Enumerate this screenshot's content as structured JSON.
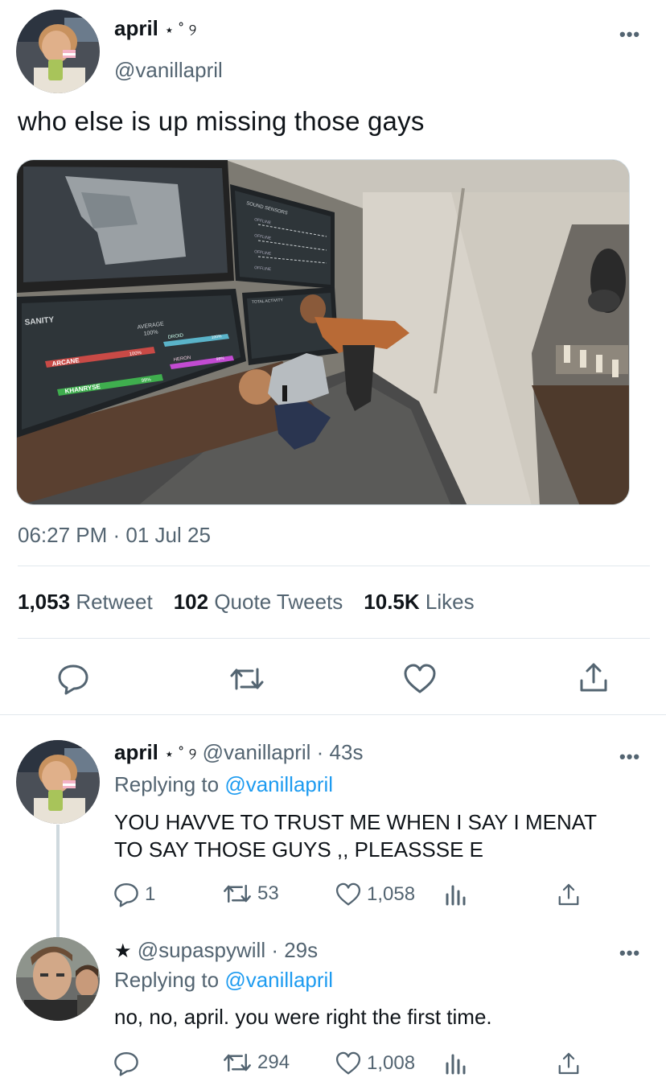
{
  "main_tweet": {
    "display_name": "april",
    "name_decor": "⋆ ˚ ୨",
    "handle": "@vanillapril",
    "text": "who else is up missing those gays",
    "timestamp": "06:27 PM · 01 Jul 25",
    "stats": {
      "retweets_count": "1,053",
      "retweets_label": "Retweet",
      "quotes_count": "102",
      "quotes_label": "Quote Tweets",
      "likes_count": "10.5K",
      "likes_label": "Likes"
    },
    "media": {
      "sanity_label": "SANITY",
      "average_label": "AVERAGE",
      "average_value": "100%",
      "players": [
        {
          "name": "ARCANE",
          "percent": "100%",
          "color": "#d9534f"
        },
        {
          "name": "KHANRYSE",
          "percent": "99%",
          "color": "#3fb950"
        },
        {
          "name": "DROID",
          "percent": "100%",
          "color": "#5bc0de"
        },
        {
          "name": "HERON",
          "percent": "99%",
          "color": "#c44bd0"
        }
      ],
      "sound_sensors_label": "SOUND SENSORS",
      "sensor_labels": [
        "OFFLINE",
        "OFFLINE",
        "OFFLINE",
        "OFFLINE"
      ],
      "activity_label": "TOTAL ACTIVITY"
    }
  },
  "replies": [
    {
      "display_name": "april",
      "name_decor": "⋆ ˚ ୨",
      "handle": "@vanillapril",
      "time": "· 43s",
      "replying_prefix": "Replying to",
      "replying_to": "@vanillapril",
      "text_line1": "YOU HAVVE TO TRUST ME WHEN I SAY I MENAT",
      "text_line2": "TO SAY THOSE GUYS ,, PLEASSSE E",
      "reply_count": "1",
      "retweet_count": "53",
      "like_count": "1,058"
    },
    {
      "display_name": "★",
      "handle": "@supaspywill",
      "time": "· 29s",
      "replying_prefix": "Replying to",
      "replying_to": "@vanillapril",
      "text": "no, no, april. you were right the first time.",
      "reply_count": "",
      "retweet_count": "294",
      "like_count": "1,008"
    }
  ],
  "colors": {
    "text": "#0f1419",
    "muted": "#536471",
    "link": "#1d9bf0",
    "divider": "#e1e8ed"
  },
  "icons": [
    "more-icon",
    "reply-icon",
    "retweet-icon",
    "like-icon",
    "share-icon",
    "analytics-icon"
  ]
}
